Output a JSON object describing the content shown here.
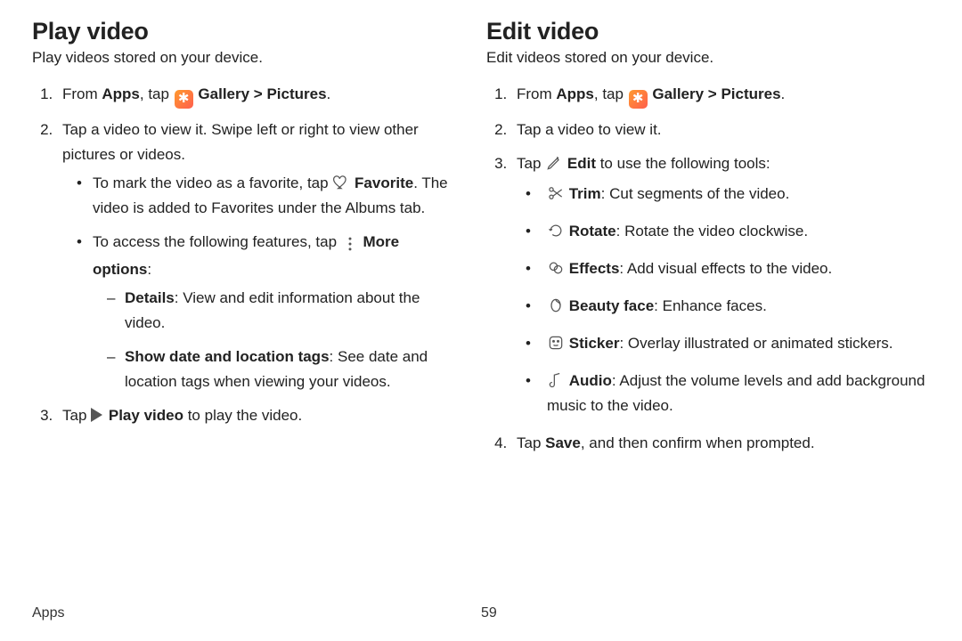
{
  "footer": {
    "section": "Apps",
    "page": "59"
  },
  "left": {
    "title": "Play video",
    "subtitle": "Play videos stored on your device.",
    "step1": {
      "pre": "From ",
      "apps": "Apps",
      "tap": ", tap ",
      "gallery": " Gallery",
      "arrow": " > ",
      "pictures": "Pictures",
      "end": "."
    },
    "step2": {
      "text": "Tap a video to view it. Swipe left or right to view other pictures or videos.",
      "fav": {
        "pre": "To mark the video as a favorite, tap ",
        "favorite": "Favorite",
        "post": ". The video is added to Favorites under the Albums tab."
      },
      "more": {
        "pre": "To access the following features, tap ",
        "more": "More options",
        "post": ":"
      },
      "details": {
        "label": "Details",
        "desc": ": View and edit information about the video."
      },
      "tags": {
        "label": "Show date and location tags",
        "desc": ": See date and location tags when viewing your videos."
      }
    },
    "step3": {
      "pre": "Tap ",
      "play": "Play video",
      "post": " to play the video."
    }
  },
  "right": {
    "title": "Edit video",
    "subtitle": "Edit videos stored on your device.",
    "step1": {
      "pre": "From ",
      "apps": "Apps",
      "tap": ", tap ",
      "gallery": " Gallery",
      "arrow": " > ",
      "pictures": "Pictures",
      "end": "."
    },
    "step2": "Tap a video to view it.",
    "step3": {
      "pre": " Tap ",
      "edit": "Edit",
      "post": " to use the following tools:"
    },
    "tools": {
      "trim": {
        "label": "Trim",
        "desc": ": Cut segments of the video."
      },
      "rotate": {
        "label": "Rotate",
        "desc": ": Rotate the video clockwise."
      },
      "effects": {
        "label": "Effects",
        "desc": ": Add visual effects to the video."
      },
      "beauty": {
        "label": "Beauty face",
        "desc": ": Enhance faces."
      },
      "sticker": {
        "label": "Sticker",
        "desc": ": Overlay illustrated or animated stickers."
      },
      "audio": {
        "label": "Audio",
        "desc": ": Adjust the volume levels and add background music to the video."
      }
    },
    "step4": {
      "pre": "Tap ",
      "save": "Save",
      "post": ", and then confirm when prompted."
    }
  }
}
